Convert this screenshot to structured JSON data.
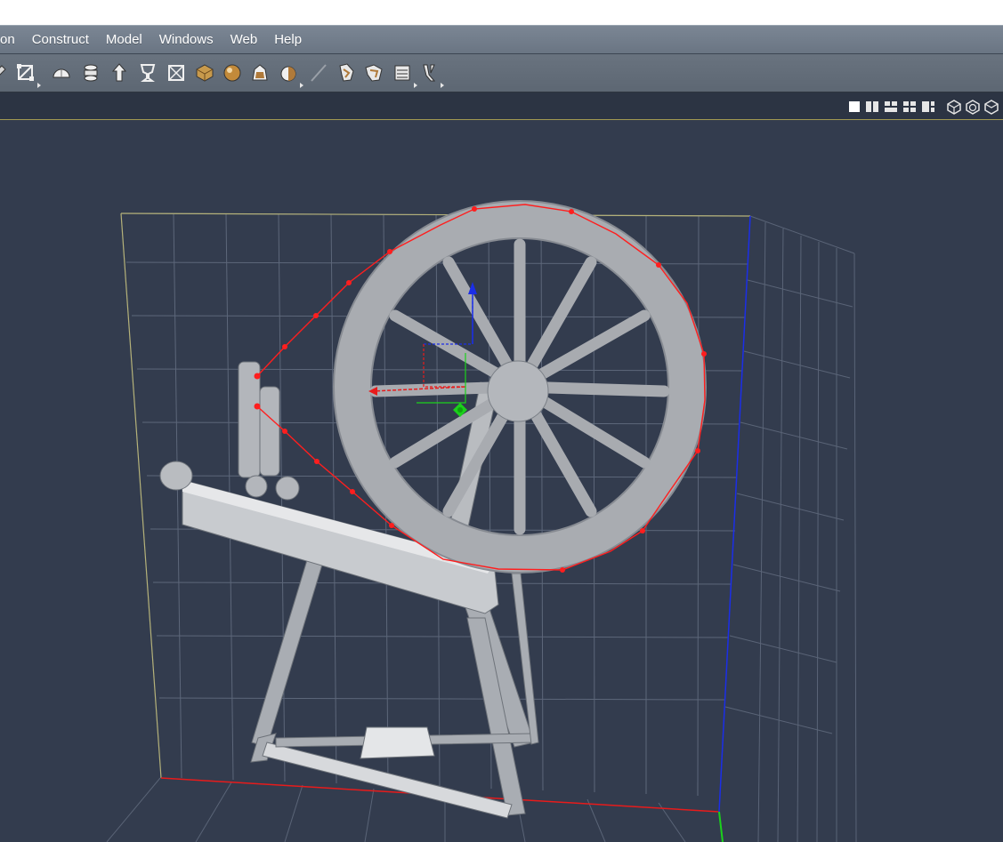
{
  "menu": {
    "items": [
      {
        "id": "menu-ion",
        "label": "on"
      },
      {
        "id": "menu-construct",
        "label": "Construct"
      },
      {
        "id": "menu-model",
        "label": "Model"
      },
      {
        "id": "menu-windows",
        "label": "Windows"
      },
      {
        "id": "menu-web",
        "label": "Web"
      },
      {
        "id": "menu-help",
        "label": "Help"
      }
    ]
  },
  "toolbar": {
    "tools": [
      {
        "icon": "scale-icon"
      },
      {
        "icon": "half-dome-icon"
      },
      {
        "icon": "lathe-icon"
      },
      {
        "icon": "arrow-extrude-icon"
      },
      {
        "icon": "goblet-icon"
      },
      {
        "icon": "boxed-x-icon"
      },
      {
        "icon": "shaded-cube-icon"
      },
      {
        "icon": "sphere-icon"
      },
      {
        "icon": "bag-icon"
      },
      {
        "icon": "half-sphere-icon"
      },
      {
        "icon": "knife-icon"
      },
      {
        "icon": "twist-icon"
      },
      {
        "icon": "bend-icon"
      },
      {
        "icon": "stretch-icon"
      },
      {
        "icon": "taper-icon"
      }
    ]
  },
  "viewbar": {
    "layout_buttons": [
      "single-view-icon",
      "two-view-icon",
      "three-view-icon",
      "four-view-icon",
      "custom-layout-icon"
    ],
    "render_buttons": [
      "wireframe-icon",
      "shaded-icon",
      "render-preview-icon"
    ]
  },
  "viewport": {
    "axis_colors": {
      "x": "#e81b1b",
      "y": "#1bd11b",
      "z": "#1b2ee8"
    },
    "grid_color": "#5d677a",
    "background": "#333c4e",
    "selection_color": "#ff1e1e"
  }
}
